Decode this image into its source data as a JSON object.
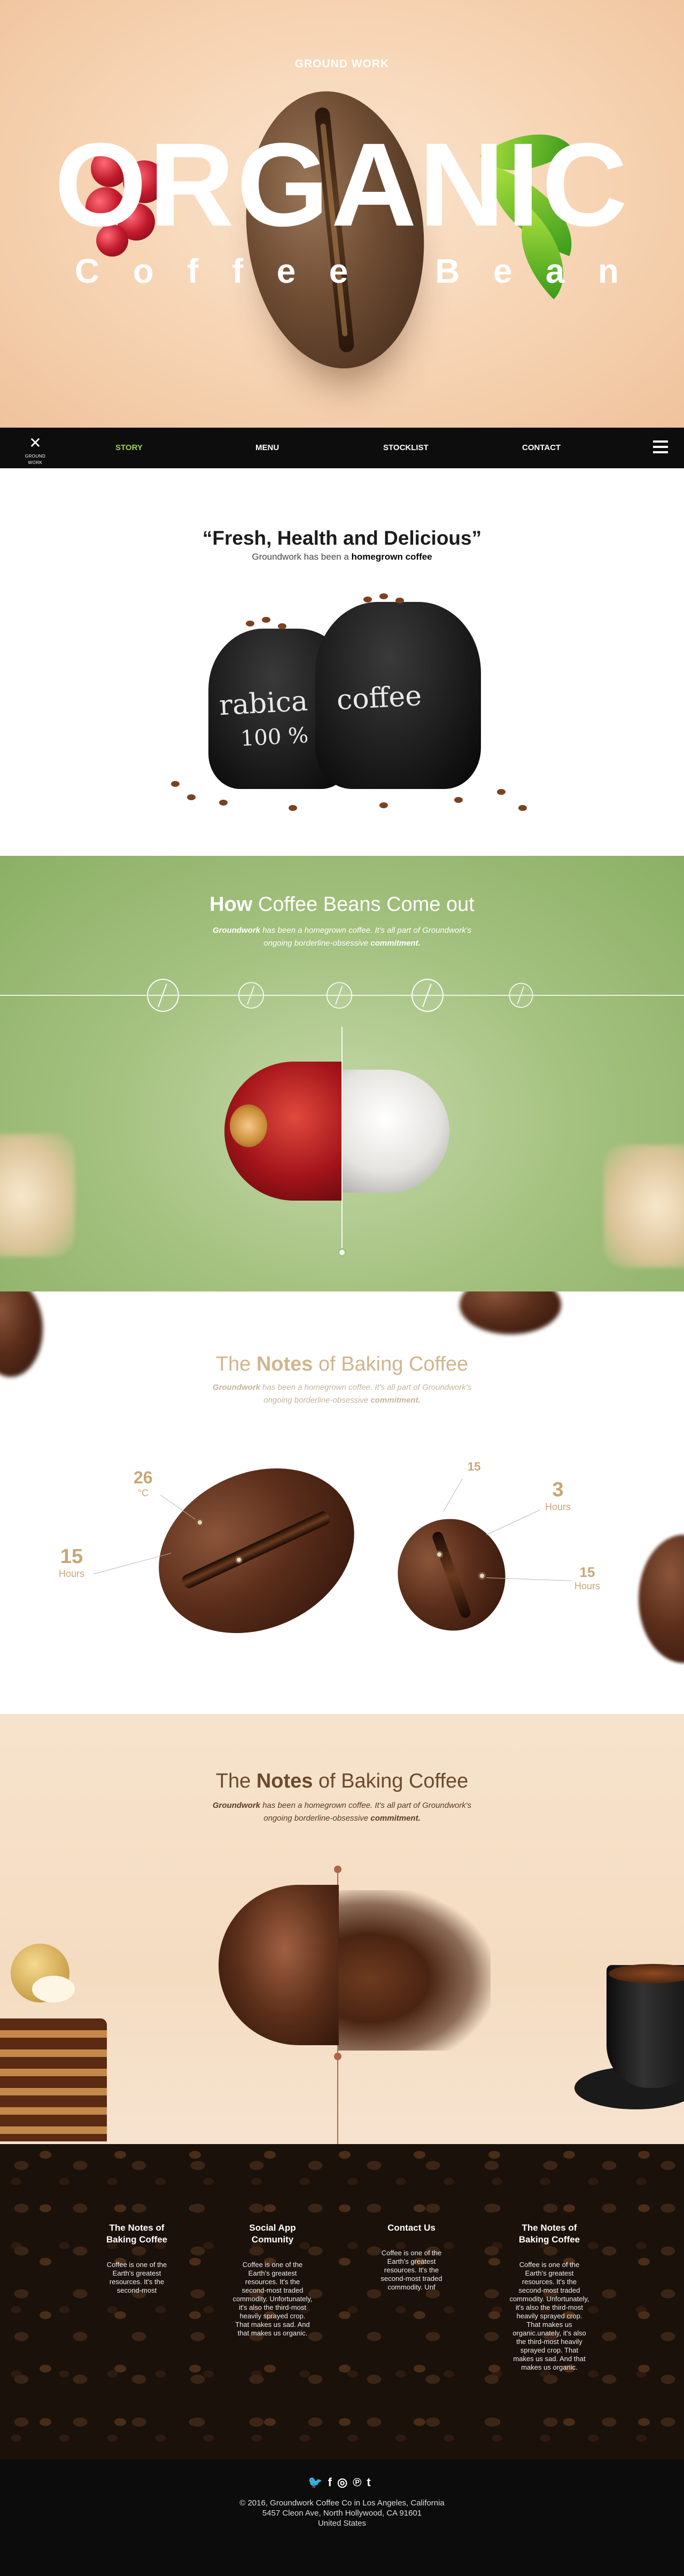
{
  "hero": {
    "brand": "GROUND WORK",
    "title": "ORGANIC",
    "subtitle_letters": [
      "C",
      "o",
      "f",
      "f",
      "e",
      "e",
      "B",
      "e",
      "a",
      "n"
    ]
  },
  "nav": {
    "logo_text": "GROUND WORK",
    "items": [
      {
        "label": "STORY",
        "active": true
      },
      {
        "label": "MENU",
        "active": false
      },
      {
        "label": "STOCKLIST",
        "active": false
      },
      {
        "label": "CONTACT",
        "active": false
      }
    ],
    "menu_icon": "hamburger-icon"
  },
  "story": {
    "quote": "“Fresh, Health and Delicious”",
    "sub_prefix": "Groundwork has been a ",
    "sub_bold": "homegrown coffee",
    "sack1_label_1": "rabica",
    "sack1_label_2": "100 %",
    "sack2_label": "coffee"
  },
  "how": {
    "title_bold": "How",
    "title_rest": " Coffee Beans Come out",
    "text_bold1": "Groundwork",
    "text_1": " has been a homegrown coffee. It's all part of Groundwork's",
    "text_2": "ongoing borderline-obsessive ",
    "text_bold2": "commitment."
  },
  "notes1": {
    "title_pre": "The ",
    "title_bold": "Notes",
    "title_post": " of Baking Coffee",
    "text_bold1": "Groundwork",
    "text_1": " has been a homegrown coffee. It's all part of Groundwork's",
    "text_2": "ongoing borderline-obsessive ",
    "text_bold2": "commitment.",
    "labels": [
      {
        "value": "26",
        "unit": "°C"
      },
      {
        "value": "15",
        "unit": "Hours"
      },
      {
        "value": "15",
        "unit": ""
      },
      {
        "value": "3",
        "unit": "Hours"
      },
      {
        "value": "15",
        "unit": "Hours"
      }
    ]
  },
  "notes2": {
    "title_pre": "The ",
    "title_bold": "Notes",
    "title_post": " of Baking Coffee",
    "text_bold1": "Groundwork",
    "text_1": " has been a homegrown coffee. It's all part of Groundwork's",
    "text_2": "ongoing borderline-obsessive ",
    "text_bold2": "commitment."
  },
  "footer": {
    "columns": [
      {
        "title": "The Notes of Baking Coffee",
        "text": "Coffee is one of the Earth's greatest resources. It's the second-most"
      },
      {
        "title": "Social App Comunity",
        "text": "Coffee is one of the Earth's greatest resources. It's the second-most traded commodity. Unfortunately, it's also the third-most heavily sprayed crop. That makes us sad. And that makes us organic."
      },
      {
        "title": "Contact Us",
        "text": "Coffee is one of the Earth's greatest resources. It's the second-most traded commodity. Unf"
      },
      {
        "title": "The Notes of Baking Coffee",
        "text": "Coffee is one of the Earth's greatest resources. It's the second-most traded commodity. Unfortunately, it's also the third-most heavily sprayed crop. That makes us organic.unately, it's also the third-most heavily sprayed crop. That makes us sad. And that makes us organic."
      }
    ],
    "socials": [
      "twitter-icon",
      "facebook-icon",
      "instagram-icon",
      "pinterest-icon",
      "tumblr-icon"
    ],
    "social_glyphs": [
      "🐦",
      "f",
      "◎",
      "℗",
      "t"
    ],
    "copyright_1": "© 2016, Groundwork Coffee Co in Los Angeles, California",
    "copyright_2": "5457 Cleon Ave, North Hollywood, CA 91601",
    "copyright_3": "United States"
  },
  "colors": {
    "accent_green": "#9fd24a",
    "gold": "#c9a675",
    "brown": "#5a2d1a"
  }
}
